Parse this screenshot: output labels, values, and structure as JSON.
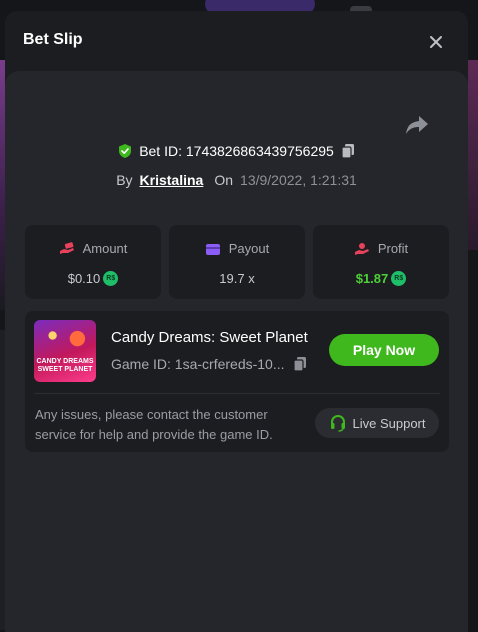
{
  "modal": {
    "title": "Bet Slip"
  },
  "bet": {
    "id_text": "Bet ID: 1743826863439756295",
    "by_label": "By",
    "username": "Kristalina",
    "on_label": "On",
    "datetime": "13/9/2022, 1:21:31"
  },
  "stats": {
    "amount": {
      "label": "Amount",
      "value": "$0.10",
      "currency": "R$"
    },
    "payout": {
      "label": "Payout",
      "value": "19.7 x"
    },
    "profit": {
      "label": "Profit",
      "value": "$1.87",
      "currency": "R$"
    }
  },
  "game": {
    "title": "Candy Dreams: Sweet Planet",
    "id_text": "Game ID: 1sa-crfereds-10...",
    "thumb_line1": "CANDY DREAMS",
    "thumb_line2": "SWEET PLANET",
    "play_label": "Play Now",
    "notice": "Any issues, please contact the customer service for help and provide the game ID.",
    "support_label": "Live Support"
  },
  "colors": {
    "accent_green": "#3fb81e",
    "profit_green": "#4cd137",
    "amount_icon": "#e8415b",
    "payout_icon": "#8b5cf6",
    "profit_icon": "#e8415b"
  },
  "icons": {
    "close": "close-icon",
    "share": "share-icon",
    "shield": "shield-check-icon",
    "copy": "copy-icon",
    "amount": "money-hand-icon",
    "payout": "wallet-icon",
    "profit": "profit-hand-icon",
    "support": "headset-icon"
  }
}
